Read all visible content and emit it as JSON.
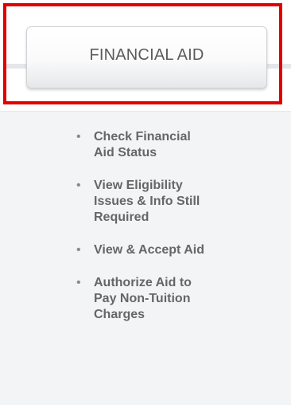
{
  "nav": {
    "title": "FINANCIAL AID",
    "links": [
      {
        "label_lines": [
          "Check Financial",
          "Aid Status"
        ]
      },
      {
        "label_lines": [
          "View Eligibility",
          "Issues & Info Still",
          "Required"
        ]
      },
      {
        "label_lines": [
          "View & Accept Aid"
        ]
      },
      {
        "label_lines": [
          "Authorize Aid to",
          "Pay Non-Tuition",
          "Charges"
        ]
      }
    ],
    "bullet_glyph": "•"
  },
  "colors": {
    "highlight": "#e00000",
    "panel_bg": "#f3f4f6",
    "link_text": "#666666",
    "title_text": "#5b5b5b"
  }
}
